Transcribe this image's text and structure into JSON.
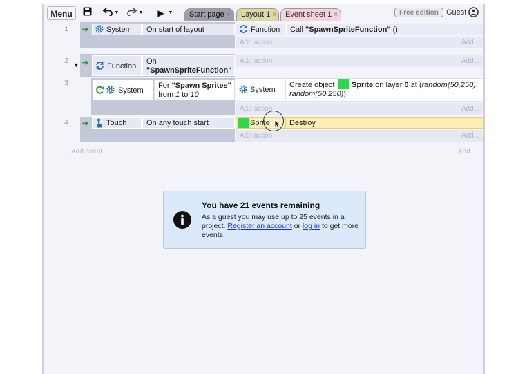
{
  "toolbar": {
    "menu_label": "Menu",
    "save_icon": "save-icon",
    "undo_icon": "undo-icon",
    "redo_icon": "redo-icon",
    "play_icon": "play-icon",
    "tabs": [
      {
        "label": "Start page",
        "close": "×"
      },
      {
        "label": "Layout 1",
        "close": "×"
      },
      {
        "label": "Event sheet 1",
        "close": "×"
      }
    ],
    "edition_badge": "Free edition",
    "user_label": "Guest"
  },
  "events": [
    {
      "number": "1",
      "condition_object": "System",
      "condition_text": "On start of layout",
      "action_object": "Function",
      "action_text_prefix": "Call ",
      "action_text_bold": "\"SpawnSpriteFunction\"",
      "action_text_suffix": " ()",
      "add_action_left": "Add action",
      "add_action_right": "Add..."
    },
    {
      "number": "2",
      "condition_object": "Function",
      "condition_text_line1": "On",
      "condition_text_line2": "\"SpawnSpriteFunction\"",
      "add_action_left": "Add action",
      "add_action_right": "Add..."
    },
    {
      "number": "3",
      "condition_object": "System",
      "condition_text_line1_prefix": "For ",
      "condition_text_line1_bold": "\"Spawn Sprites\"",
      "condition_text_line2_prefix": "from ",
      "condition_text_line2_from": "1",
      "condition_text_line2_mid": " to ",
      "condition_text_line2_to": "10",
      "action_object": "System",
      "action_line1_prefix": "Create object",
      "action_line1_object": "Sprite",
      "action_line1_mid": " on layer ",
      "action_line1_layer": "0",
      "action_line1_at": " at (",
      "action_line1_expr": "random(50,250)",
      "action_line1_comma": ",",
      "action_line2_expr": "random(50,250)",
      "action_line2_close": ")",
      "add_action_left": "Add action",
      "add_action_right": "Add..."
    },
    {
      "number": "4",
      "condition_object": "Touch",
      "condition_text": "On any touch start",
      "action_object": "Sprite",
      "action_text": "Destroy",
      "add_action_left": "Add action",
      "add_action_right": "Add..."
    }
  ],
  "add_event": {
    "left": "Add event",
    "right": "Add..."
  },
  "notice": {
    "title": "You have 21 events remaining",
    "body_1": "As a guest you may use up to 25 events in a project. ",
    "link_register": "Register an account",
    "body_or": " or ",
    "link_login": "log in",
    "body_2": " to get more events."
  },
  "colors": {
    "sprite_green": "#31d84e",
    "highlight": "#fbefb5",
    "notice_bg": "#dbe9fb"
  }
}
